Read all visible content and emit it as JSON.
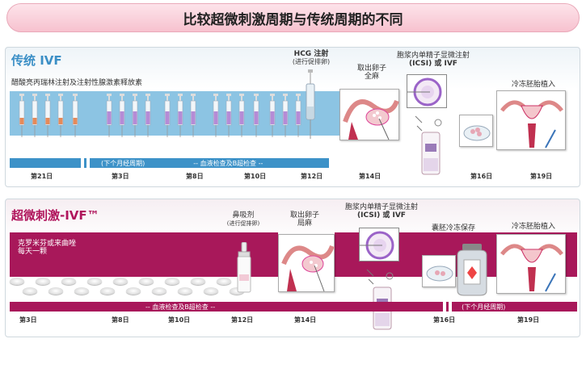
{
  "title": "比较超微刺激周期与传统周期的不同",
  "ivf": {
    "title": "传统 IVF",
    "injection_label": "醋酸亮丙瑞林注射及注射性腺激素释放素",
    "hcg_label": "HCG 注射",
    "hcg_sub": "(进行促排卵)",
    "retrieval_label": "取出卵子",
    "retrieval_sub": "全麻",
    "icsi_label": "胞浆内单精子显微注射",
    "icsi_sub": "(ICSI) 或 IVF",
    "transfer_label": "冷冻胚胎植入",
    "bar_left": "(下个月经周期)",
    "bar_mid": "--   血液检查及B超检查   --",
    "days": [
      "第21日",
      "第3日",
      "第8日",
      "第10日",
      "第12日",
      "第14日",
      "第16日",
      "第19日"
    ]
  },
  "mini": {
    "title": "超微刺激-IVF™",
    "drug_label": "克罗米芬或来曲唑",
    "drug_sub": "每天一颗",
    "spray_label": "鼻吸剂",
    "spray_sub": "(进行促排卵)",
    "retrieval_label": "取出卵子",
    "retrieval_sub": "局麻",
    "icsi_label": "胞浆内单精子显微注射",
    "icsi_sub": "(ICSI) 或 IVF",
    "freeze_label": "囊胚冷冻保存",
    "transfer_label": "冷冻胚胎植入",
    "bar_mid": "--   血液检查及B超检查   --",
    "bar_right": "(下个月经周期)",
    "days": [
      "第3日",
      "第8日",
      "第10日",
      "第12日",
      "第14日",
      "第16日",
      "第19日"
    ]
  },
  "colors": {
    "ivf_band": "#8cc4e3",
    "ivf_bar": "#3d92c8",
    "mini_band": "#a8185a",
    "mini_bar": "#a8185a",
    "ivf_title": "#3b8fc6",
    "mini_title": "#b0155c"
  }
}
